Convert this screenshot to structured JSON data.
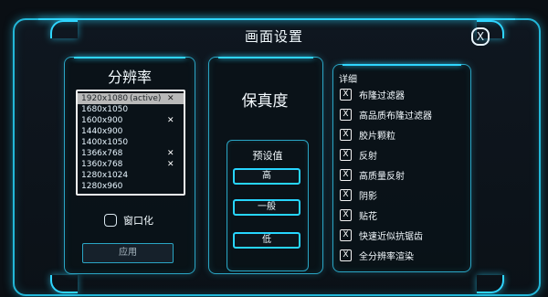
{
  "dialog": {
    "title": "画面设置",
    "close_label": "X"
  },
  "resolution": {
    "title": "分辨率",
    "items": [
      {
        "label": "1920x1080",
        "note": "(active)",
        "mark": "✕",
        "active": true
      },
      {
        "label": "1680x1050",
        "note": "",
        "mark": ""
      },
      {
        "label": "1600x900",
        "note": "",
        "mark": "✕"
      },
      {
        "label": "1440x900",
        "note": "",
        "mark": ""
      },
      {
        "label": "1400x1050",
        "note": "",
        "mark": ""
      },
      {
        "label": "1366x768",
        "note": "",
        "mark": "✕"
      },
      {
        "label": "1360x768",
        "note": "",
        "mark": "✕"
      },
      {
        "label": "1280x1024",
        "note": "",
        "mark": ""
      },
      {
        "label": "1280x960",
        "note": "",
        "mark": ""
      }
    ],
    "windowed_label": "窗口化",
    "apply_label": "应用"
  },
  "quality": {
    "title": "保真度",
    "presets_title": "预设值",
    "presets": [
      "高",
      "一般",
      "低"
    ]
  },
  "details": {
    "title": "详细",
    "items": [
      {
        "label": "布隆过滤器",
        "checked": "X"
      },
      {
        "label": "高品质布隆过滤器",
        "checked": "X"
      },
      {
        "label": "胶片颗粒",
        "checked": "X"
      },
      {
        "label": "反射",
        "checked": "X"
      },
      {
        "label": "高质量反射",
        "checked": "X"
      },
      {
        "label": "阴影",
        "checked": "X"
      },
      {
        "label": "贴花",
        "checked": "X"
      },
      {
        "label": "快速近似抗锯齿",
        "checked": "X"
      },
      {
        "label": "全分辨率渲染",
        "checked": "X"
      }
    ]
  },
  "colors": {
    "accent": "#2fd5ff",
    "panel_border": "#2aa5c4",
    "active_row": "#b9b9b9"
  }
}
